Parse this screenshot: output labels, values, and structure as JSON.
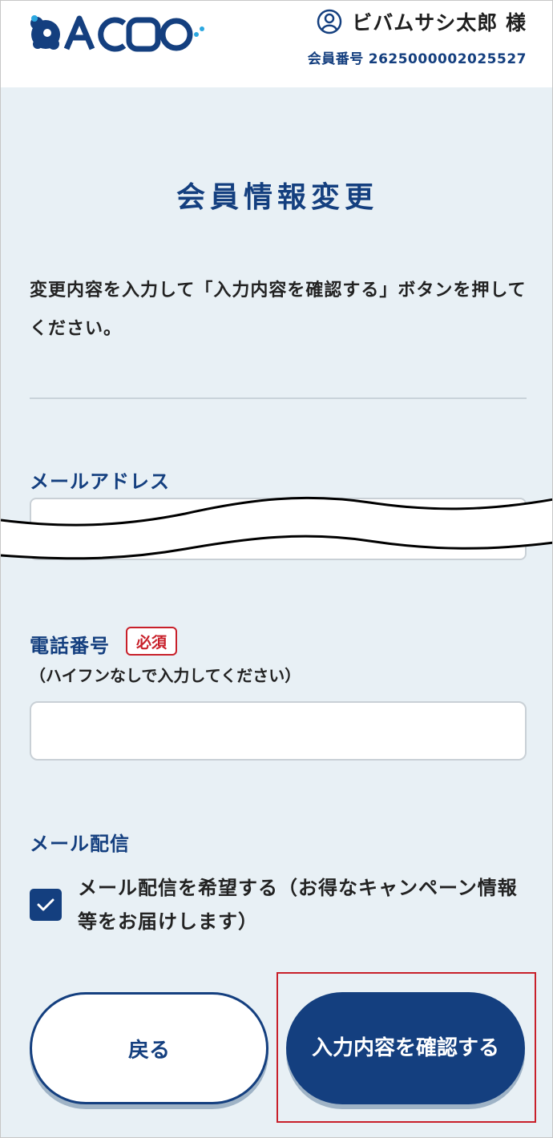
{
  "header": {
    "logo_text": "ACOO",
    "user_name": "ビバムサシ太郎 様",
    "member_label": "会員番号",
    "member_number": "2625000002025527"
  },
  "page": {
    "title": "会員情報変更",
    "intro": "変更内容を入力して「入力内容を確認する」ボタンを押してください。"
  },
  "form": {
    "email_label": "メールアドレス",
    "email_value": "",
    "phone_label": "電話番号",
    "phone_required": "必須",
    "phone_hint": "（ハイフンなしで入力してください）",
    "phone_value": "",
    "mail_label": "メール配信",
    "mail_checkbox_label": "メール配信を希望する（お得なキャンペーン情報等をお届けします）",
    "mail_checked": true
  },
  "buttons": {
    "back": "戻る",
    "confirm": "入力内容を確認する"
  },
  "colors": {
    "brand": "#143f7f",
    "background": "#e8f0f5",
    "required": "#c8202a"
  }
}
